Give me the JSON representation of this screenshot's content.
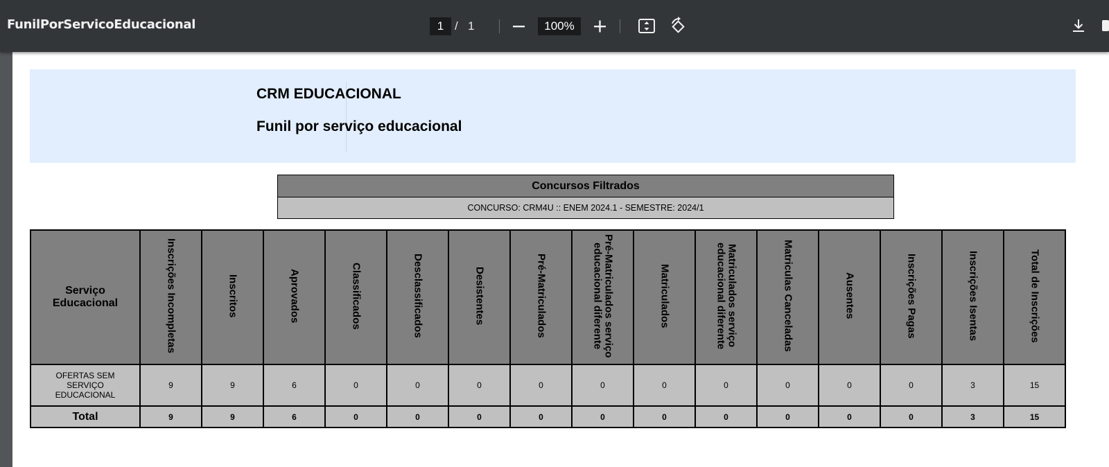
{
  "toolbar": {
    "title": "FunilPorServicoEducacional",
    "current_page": "1",
    "page_separator": "/",
    "total_pages": "1",
    "zoom": "100%"
  },
  "report": {
    "title": "CRM EDUCACIONAL",
    "subtitle": "Funil por serviço educacional",
    "filter_header": "Concursos Filtrados",
    "filter_value": "CONCURSO: CRM4U :: ENEM 2024.1 - SEMESTRE: 2024/1"
  },
  "table": {
    "first_header": "Serviço Educacional",
    "headers": [
      "Inscrições Incompletas",
      "Inscritos",
      "Aprovados",
      "Classificados",
      "Desclassificados",
      "Desistentes",
      "Pré-Matriculados",
      "Pré-Matriculados serviço educacional diferente",
      "Matriculados",
      "Matriculados serviço educacional diferente",
      "Matriculas Canceladas",
      "Ausentes",
      "Inscrições Pagas",
      "Inscrições Isentas",
      "Total de Inscrições"
    ],
    "row": {
      "label": "OFERTAS SEM SERVIÇO EDUCACIONAL",
      "values": [
        "9",
        "9",
        "6",
        "0",
        "0",
        "0",
        "0",
        "0",
        "0",
        "0",
        "0",
        "0",
        "0",
        "3",
        "15"
      ]
    },
    "total": {
      "label": "Total",
      "values": [
        "9",
        "9",
        "6",
        "0",
        "0",
        "0",
        "0",
        "0",
        "0",
        "0",
        "0",
        "0",
        "0",
        "3",
        "15"
      ]
    }
  }
}
